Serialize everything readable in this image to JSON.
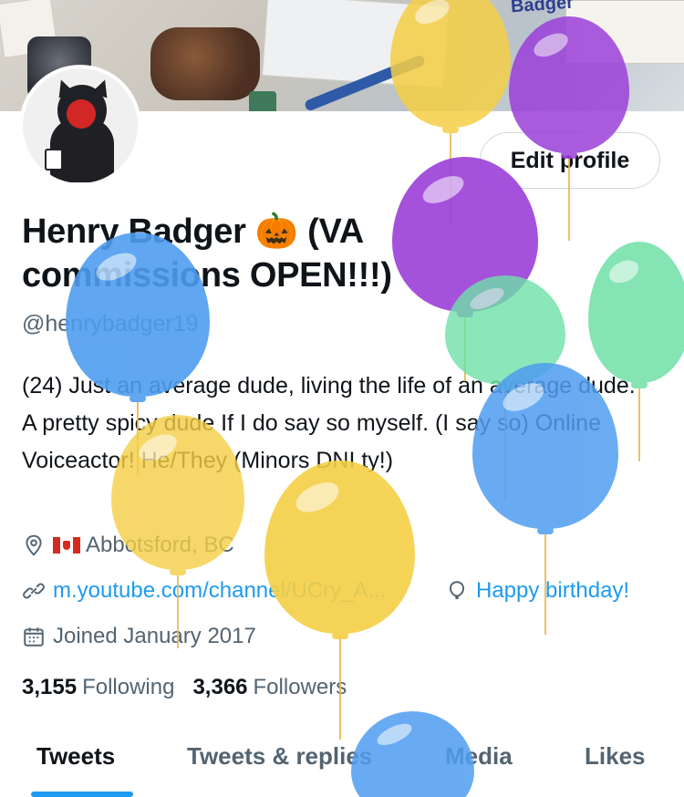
{
  "banner": {
    "text": "Badger"
  },
  "profile": {
    "edit_label": "Edit profile",
    "display_name": "Henry Badger 🎃 (VA commissions OPEN!!!)",
    "handle": "@henrybadger19",
    "bio": "(24) Just an average dude, living the life of an average dude. A pretty spicy dude If I do say so myself. (I say so) Online Voiceactor! He/They (Minors DNI ty!)",
    "location": "Abbotsford, BC",
    "link": "m.youtube.com/channel/UCry_A...",
    "birthday": "Happy birthday!",
    "joined": "Joined January 2017",
    "following_count": "3,155",
    "following_label": "Following",
    "followers_count": "3,366",
    "followers_label": "Followers"
  },
  "tabs": [
    {
      "label": "Tweets"
    },
    {
      "label": "Tweets & replies"
    },
    {
      "label": "Media"
    },
    {
      "label": "Likes"
    }
  ],
  "colors": {
    "accent": "#1d9bf0",
    "balloon_yellow": "#f5cf45",
    "balloon_purple": "#9b3fd9",
    "balloon_blue": "#4f9df0",
    "balloon_green": "#6fe0a8"
  }
}
